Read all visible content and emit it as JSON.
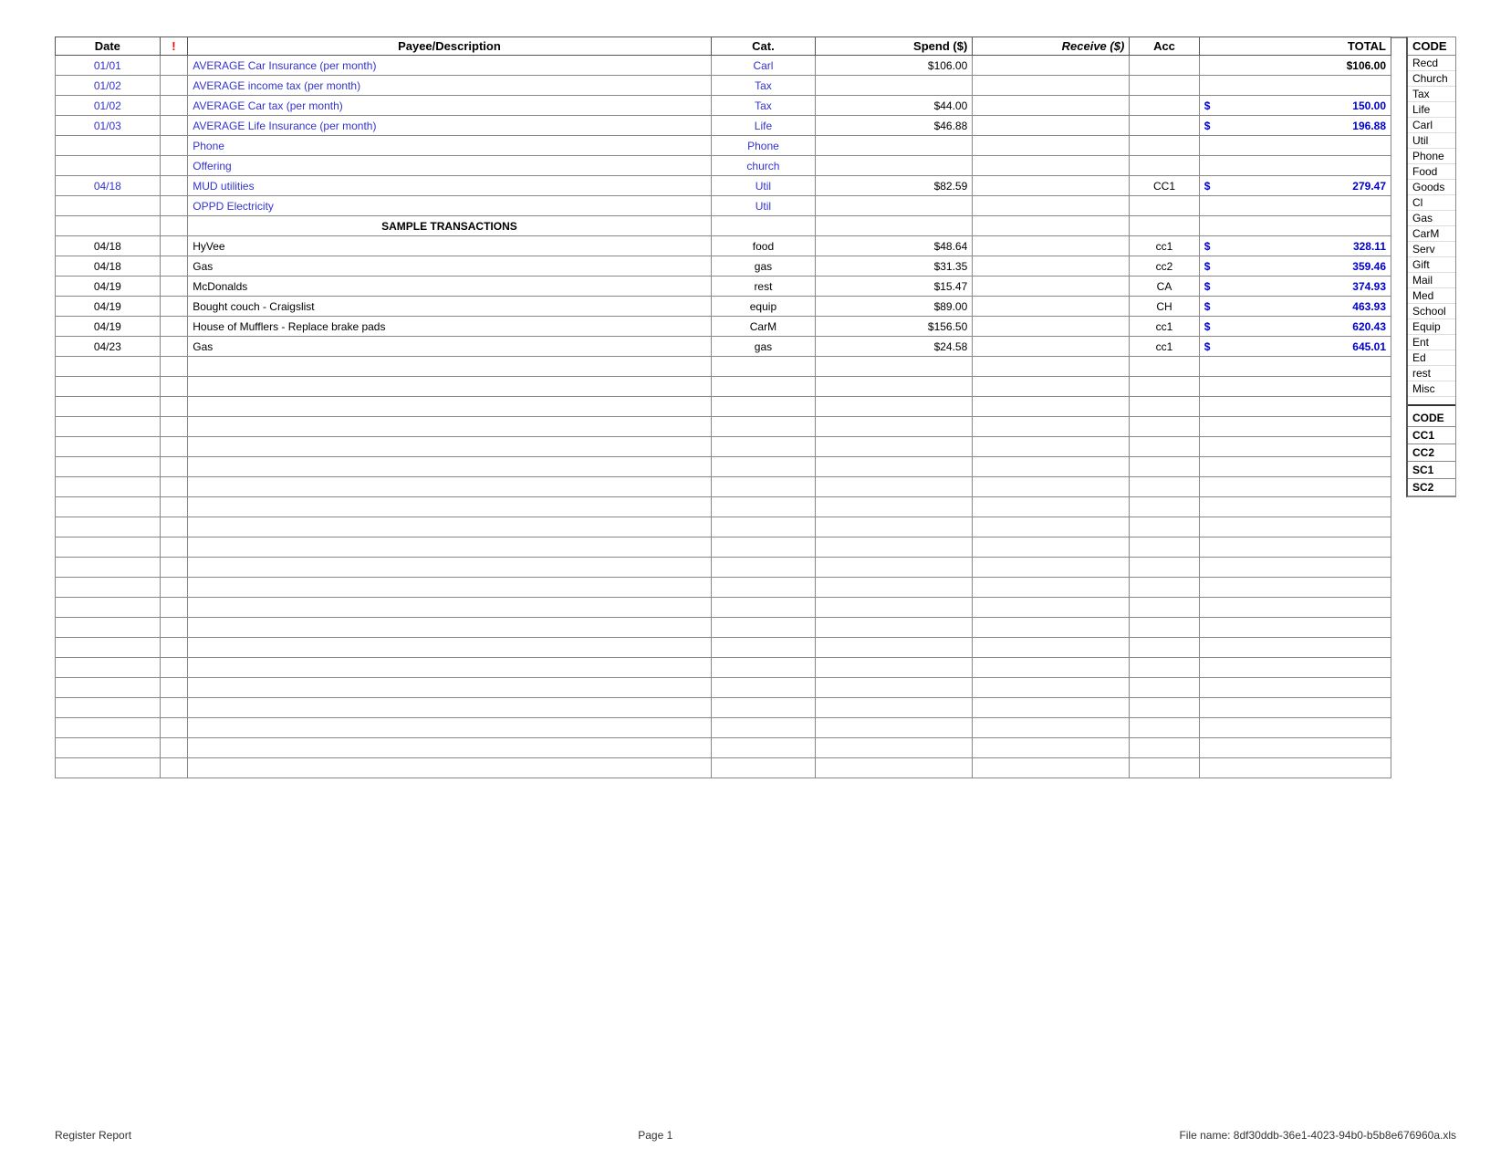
{
  "header": {
    "columns": {
      "date": "Date",
      "flag": "!",
      "payee": "Payee/Description",
      "cat": "Cat.",
      "spend": "Spend ($)",
      "receive": "Receive ($)",
      "acc": "Acc",
      "total": "TOTAL",
      "code": "CODE"
    }
  },
  "rows": [
    {
      "date": "01/01",
      "flag": "",
      "payee": "AVERAGE Car Insurance (per month)",
      "cat": "Carl",
      "spend": "$106.00",
      "receive": "",
      "acc": "",
      "total": "$106.00",
      "style": "blue",
      "totalStyle": "plain"
    },
    {
      "date": "01/02",
      "flag": "",
      "payee": "AVERAGE income tax (per month)",
      "cat": "Tax",
      "spend": "",
      "receive": "",
      "acc": "",
      "total": "",
      "style": "blue",
      "totalStyle": ""
    },
    {
      "date": "01/02",
      "flag": "",
      "payee": "AVERAGE Car tax (per month)",
      "cat": "Tax",
      "spend": "$44.00",
      "receive": "",
      "acc": "",
      "total": "150.00",
      "style": "blue",
      "totalStyle": "dollar"
    },
    {
      "date": "01/03",
      "flag": "",
      "payee": "AVERAGE Life Insurance (per month)",
      "cat": "Life",
      "spend": "$46.88",
      "receive": "",
      "acc": "",
      "total": "196.88",
      "style": "blue",
      "totalStyle": "dollar"
    },
    {
      "date": "",
      "flag": "",
      "payee": "Phone",
      "cat": "Phone",
      "spend": "",
      "receive": "",
      "acc": "",
      "total": "",
      "style": "blue",
      "totalStyle": ""
    },
    {
      "date": "",
      "flag": "",
      "payee": "Offering",
      "cat": "church",
      "spend": "",
      "receive": "",
      "acc": "",
      "total": "",
      "style": "blue",
      "totalStyle": ""
    },
    {
      "date": "04/18",
      "flag": "",
      "payee": "MUD utilities",
      "cat": "Util",
      "spend": "$82.59",
      "receive": "",
      "acc": "CC1",
      "total": "279.47",
      "style": "blue",
      "totalStyle": "dollar"
    },
    {
      "date": "",
      "flag": "",
      "payee": "OPPD Electricity",
      "cat": "Util",
      "spend": "",
      "receive": "",
      "acc": "",
      "total": "",
      "style": "blue",
      "totalStyle": ""
    },
    {
      "date": "",
      "flag": "",
      "payee": "SAMPLE TRANSACTIONS",
      "cat": "",
      "spend": "",
      "receive": "",
      "acc": "",
      "total": "",
      "style": "sample",
      "totalStyle": ""
    },
    {
      "date": "04/18",
      "flag": "",
      "payee": "HyVee",
      "cat": "food",
      "spend": "$48.64",
      "receive": "",
      "acc": "cc1",
      "total": "328.11",
      "style": "normal",
      "totalStyle": "dollar"
    },
    {
      "date": "04/18",
      "flag": "",
      "payee": "Gas",
      "cat": "gas",
      "spend": "$31.35",
      "receive": "",
      "acc": "cc2",
      "total": "359.46",
      "style": "normal",
      "totalStyle": "dollar"
    },
    {
      "date": "04/19",
      "flag": "",
      "payee": "McDonalds",
      "cat": "rest",
      "spend": "$15.47",
      "receive": "",
      "acc": "CA",
      "total": "374.93",
      "style": "normal",
      "totalStyle": "dollar"
    },
    {
      "date": "04/19",
      "flag": "",
      "payee": "Bought couch - Craigslist",
      "cat": "equip",
      "spend": "$89.00",
      "receive": "",
      "acc": "CH",
      "total": "463.93",
      "style": "normal",
      "totalStyle": "dollar"
    },
    {
      "date": "04/19",
      "flag": "",
      "payee": "House of Mufflers - Replace brake pads",
      "cat": "CarM",
      "spend": "$156.50",
      "receive": "",
      "acc": "cc1",
      "total": "620.43",
      "style": "normal",
      "totalStyle": "dollar"
    },
    {
      "date": "04/23",
      "flag": "",
      "payee": "Gas",
      "cat": "gas",
      "spend": "$24.58",
      "receive": "",
      "acc": "cc1",
      "total": "645.01",
      "style": "normal",
      "totalStyle": "dollar"
    },
    {
      "date": "",
      "flag": "",
      "payee": "",
      "cat": "",
      "spend": "",
      "receive": "",
      "acc": "",
      "total": "",
      "style": "empty"
    },
    {
      "date": "",
      "flag": "",
      "payee": "",
      "cat": "",
      "spend": "",
      "receive": "",
      "acc": "",
      "total": "",
      "style": "empty"
    },
    {
      "date": "",
      "flag": "",
      "payee": "",
      "cat": "",
      "spend": "",
      "receive": "",
      "acc": "",
      "total": "",
      "style": "empty"
    },
    {
      "date": "",
      "flag": "",
      "payee": "",
      "cat": "",
      "spend": "",
      "receive": "",
      "acc": "",
      "total": "",
      "style": "empty"
    },
    {
      "date": "",
      "flag": "",
      "payee": "",
      "cat": "",
      "spend": "",
      "receive": "",
      "acc": "",
      "total": "",
      "style": "empty"
    },
    {
      "date": "",
      "flag": "",
      "payee": "",
      "cat": "",
      "spend": "",
      "receive": "",
      "acc": "",
      "total": "",
      "style": "empty"
    },
    {
      "date": "",
      "flag": "",
      "payee": "",
      "cat": "",
      "spend": "",
      "receive": "",
      "acc": "",
      "total": "",
      "style": "empty"
    },
    {
      "date": "",
      "flag": "",
      "payee": "",
      "cat": "",
      "spend": "",
      "receive": "",
      "acc": "",
      "total": "",
      "style": "empty"
    },
    {
      "date": "",
      "flag": "",
      "payee": "",
      "cat": "",
      "spend": "",
      "receive": "",
      "acc": "",
      "total": "",
      "style": "empty"
    },
    {
      "date": "",
      "flag": "",
      "payee": "",
      "cat": "",
      "spend": "",
      "receive": "",
      "acc": "",
      "total": "",
      "style": "empty"
    },
    {
      "date": "",
      "flag": "",
      "payee": "",
      "cat": "",
      "spend": "",
      "receive": "",
      "acc": "",
      "total": "",
      "style": "empty"
    },
    {
      "date": "",
      "flag": "",
      "payee": "",
      "cat": "",
      "spend": "",
      "receive": "",
      "acc": "",
      "total": "",
      "style": "empty"
    },
    {
      "date": "",
      "flag": "",
      "payee": "",
      "cat": "",
      "spend": "",
      "receive": "",
      "acc": "",
      "total": "",
      "style": "empty"
    },
    {
      "date": "",
      "flag": "",
      "payee": "",
      "cat": "",
      "spend": "",
      "receive": "",
      "acc": "",
      "total": "",
      "style": "empty"
    },
    {
      "date": "",
      "flag": "",
      "payee": "",
      "cat": "",
      "spend": "",
      "receive": "",
      "acc": "",
      "total": "",
      "style": "empty"
    },
    {
      "date": "",
      "flag": "",
      "payee": "",
      "cat": "",
      "spend": "",
      "receive": "",
      "acc": "",
      "total": "",
      "style": "empty"
    },
    {
      "date": "",
      "flag": "",
      "payee": "",
      "cat": "",
      "spend": "",
      "receive": "",
      "acc": "",
      "total": "",
      "style": "empty"
    },
    {
      "date": "",
      "flag": "",
      "payee": "",
      "cat": "",
      "spend": "",
      "receive": "",
      "acc": "",
      "total": "",
      "style": "empty"
    },
    {
      "date": "",
      "flag": "",
      "payee": "",
      "cat": "",
      "spend": "",
      "receive": "",
      "acc": "",
      "total": "",
      "style": "empty"
    },
    {
      "date": "",
      "flag": "",
      "payee": "",
      "cat": "",
      "spend": "",
      "receive": "",
      "acc": "",
      "total": "",
      "style": "empty"
    },
    {
      "date": "",
      "flag": "",
      "payee": "",
      "cat": "",
      "spend": "",
      "receive": "",
      "acc": "",
      "total": "",
      "style": "empty"
    }
  ],
  "code_items": [
    "Recd",
    "Church",
    "Tax",
    "Life",
    "Carl",
    "Util",
    "Phone",
    "Food",
    "Goods",
    "Cl",
    "Gas",
    "CarM",
    "Serv",
    "Gift",
    "Mail",
    "Med",
    "School",
    "Equip",
    "Ent",
    "Ed",
    "rest",
    "Misc"
  ],
  "code_bottom": [
    "CODE",
    "CC1",
    "CC2",
    "SC1",
    "SC2"
  ],
  "footer": {
    "left": "Register Report",
    "center": "Page 1",
    "right": "File name: 8df30ddb-36e1-4023-94b0-b5b8e676960a.xls"
  }
}
